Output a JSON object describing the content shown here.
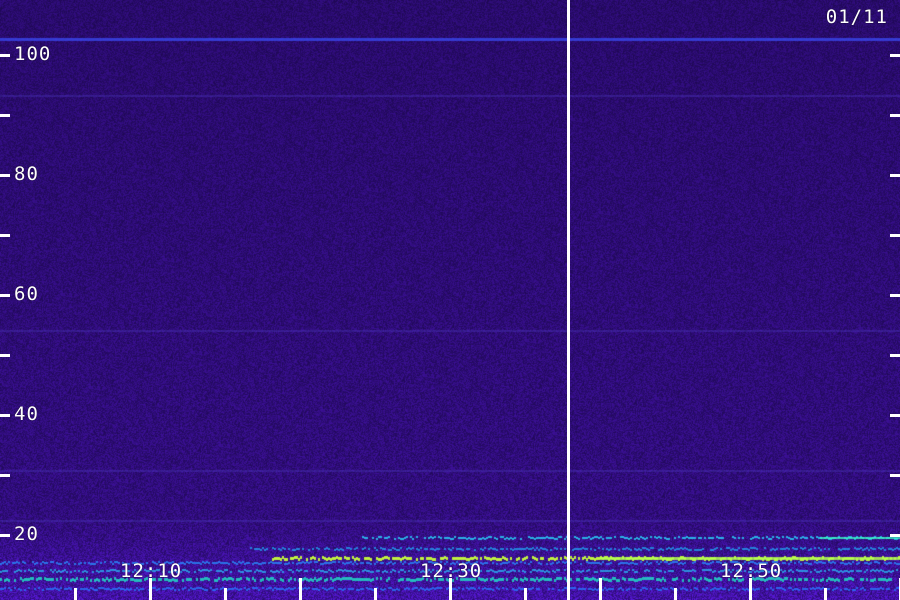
{
  "date_label": "01/11",
  "y_axis": {
    "labels": [
      "100",
      "80",
      "60",
      "40",
      "20"
    ]
  },
  "x_axis": {
    "labels": [
      "12:10",
      "12:30",
      "12:50"
    ]
  }
}
